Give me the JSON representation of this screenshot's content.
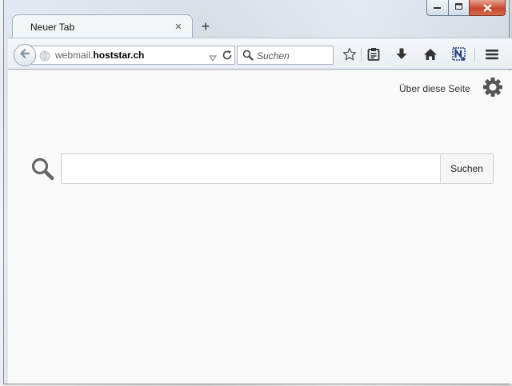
{
  "window": {
    "minimize_icon": "minimize-icon",
    "maximize_icon": "maximize-icon",
    "close_icon": "close-icon"
  },
  "tabs": [
    {
      "title": "Neuer Tab",
      "close_glyph": "×"
    }
  ],
  "new_tab_glyph": "+",
  "navbar": {
    "url_prefix": "webmail.",
    "url_host": "hoststar.ch",
    "search_placeholder": "Suchen",
    "icons": [
      "back-icon",
      "globe-icon",
      "dropdown-icon",
      "reload-icon",
      "search-icon",
      "bookmark-star-icon",
      "reading-list-icon",
      "download-icon",
      "home-icon",
      "extension-n-icon",
      "menu-icon"
    ]
  },
  "content": {
    "about_link": "Über diese Seite",
    "search_value": "",
    "search_button": "Suchen"
  },
  "colors": {
    "close_button": "#c7472e",
    "content_bg": "#f9f9f9"
  }
}
